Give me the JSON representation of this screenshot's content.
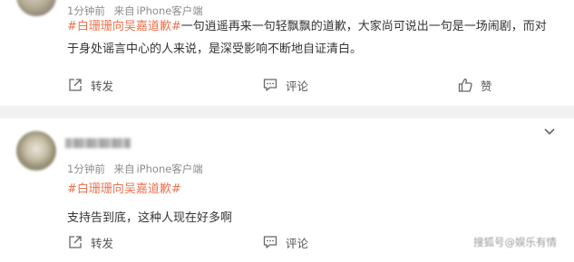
{
  "post1": {
    "meta": {
      "time": "1分钟前",
      "source_prefix": "来自",
      "source": "iPhone客户端"
    },
    "hashtag": "#白珊珊向吴嘉道歉#",
    "text": "一句逍遥再来一句轻飘飘的道歉，大家尚可说出一句是一场闹剧，而对于身处谣言中心的人来说，是深受影响不断地自证清白。",
    "actions": {
      "forward": "转发",
      "comment": "评论",
      "like": "赞"
    }
  },
  "post2": {
    "meta": {
      "time": "1分钟前",
      "source_prefix": "来自",
      "source": "iPhone客户端"
    },
    "hashtag": "#白珊珊向吴嘉道歉#",
    "text": "支持告到底，这种人现在好多啊",
    "actions": {
      "forward": "转发",
      "comment": "评论"
    },
    "watermark": "搜狐号@娱乐有情"
  },
  "colors": {
    "hashtag": "#eb7350",
    "meta": "#8c8c8c",
    "separator": "#f2f2f2"
  },
  "icons": [
    "forward-icon",
    "comment-icon",
    "like-icon",
    "chevron-down-icon"
  ]
}
